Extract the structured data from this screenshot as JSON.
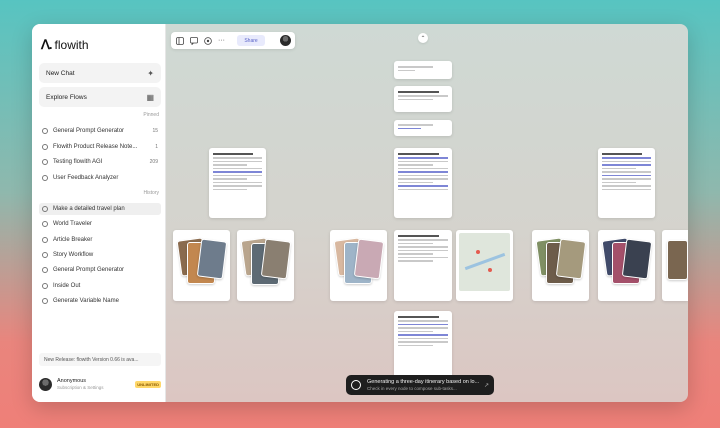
{
  "app": {
    "name": "flowith"
  },
  "sidebar": {
    "new_chat": "New Chat",
    "explore": "Explore Flows",
    "pinned_label": "Pinned",
    "pinned": [
      {
        "label": "General Prompt Generator",
        "meta": "15"
      },
      {
        "label": "Flowith Product Release Note...",
        "meta": "1"
      },
      {
        "label": "Testing flowith AGI",
        "meta": "209"
      },
      {
        "label": "User Feedback Analyzer",
        "meta": ""
      }
    ],
    "history_label": "History",
    "history": [
      {
        "label": "Make a detailed travel plan"
      },
      {
        "label": "World Traveler"
      },
      {
        "label": "Article Breaker"
      },
      {
        "label": "Story Workflow"
      },
      {
        "label": "General Prompt Generator"
      },
      {
        "label": "Inside Out"
      },
      {
        "label": "Generate Variable Name"
      }
    ],
    "release": "New Release: flowith Version 0.66 is ava...",
    "user": {
      "name": "Anonymous",
      "sub": "Subscription & Settings",
      "badge": "UNLIMITED"
    }
  },
  "toolbar": {
    "share": "Share"
  },
  "toast": {
    "title": "Generating a three-day itinerary based on lo...",
    "subtitle": "Check in every node to compose sub-tasks..."
  },
  "colors": {
    "accent": "#7e86d6",
    "toast_bg": "#1e1e1e",
    "badge": "#ffd86a"
  }
}
